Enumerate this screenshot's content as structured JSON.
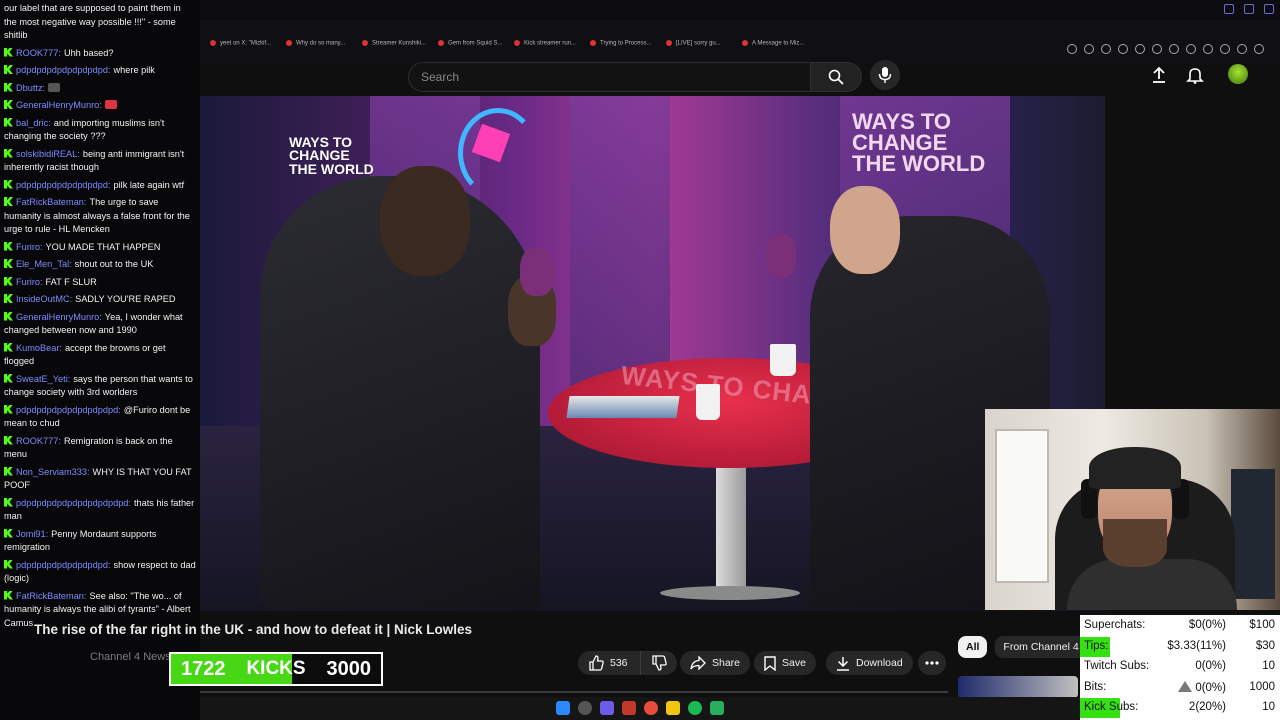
{
  "browser": {
    "bookmarks": [
      "yeet on X: \"Mizkif...",
      "Why do so many...",
      "Streamer Kunshiki...",
      "Gem from Squid S...",
      "Kick streamer run...",
      "Trying to Process...",
      "[LIVE] sorry gu...",
      "A Message to Miz..."
    ]
  },
  "youtube": {
    "search_placeholder": "Search",
    "video_title": "The rise of the far right in the UK - and how to defeat it | Nick Lowles",
    "channel_ghost": "Channel 4 News",
    "likes": "536",
    "share_label": "Share",
    "save_label": "Save",
    "download_label": "Download",
    "chips": [
      "All",
      "From Channel 4"
    ],
    "video_overlay": {
      "logo_left": [
        "WAYS TO",
        "CHANGE",
        "THE WORLD"
      ],
      "logo_right": [
        "WAYS TO",
        "CHANGE",
        "THE WORLD"
      ],
      "table_text": "WAYS TO CHANGE THE WORLD"
    }
  },
  "chat": {
    "messages": [
      {
        "user": "",
        "text": "our label that are supposed to paint them in the most negative way possible !!!\" - some shitlib"
      },
      {
        "user": "ROOK777:",
        "text": "Uhh based?"
      },
      {
        "user": "pdpdpdpdpdpdpdpdpd:",
        "text": "where pilk"
      },
      {
        "user": "Dbuttz:",
        "text": ""
      },
      {
        "user": "GeneralHenryMunro:",
        "text": ""
      },
      {
        "user": "bal_dric:",
        "text": "and importing muslims isn't changing the society ???"
      },
      {
        "user": "solskibidiREAL:",
        "text": "being anti immigrant isn't inherently racist though"
      },
      {
        "user": "pdpdpdpdpdpdpdpdpd:",
        "text": "pilk late again wtf"
      },
      {
        "user": "FatRickBateman:",
        "text": "The urge to save humanity is almost always a false front for the urge to rule - HL Mencken"
      },
      {
        "user": "Furiro:",
        "text": "YOU MADE THAT HAPPEN"
      },
      {
        "user": "Ele_Men_Tal:",
        "text": "shout out to the UK"
      },
      {
        "user": "Furiro:",
        "text": "FAT F SLUR"
      },
      {
        "user": "InsideOutMC:",
        "text": "SADLY YOU'RE RAPED"
      },
      {
        "user": "GeneralHenryMunro:",
        "text": "Yea, I wonder what changed between now and 1990"
      },
      {
        "user": "KumoBear:",
        "text": "accept the browns or get flogged"
      },
      {
        "user": "SweatE_Yeti:",
        "text": "says the person that wants to change society with 3rd worlders"
      },
      {
        "user": "pdpdpdpdpdpdpdpdpdpd:",
        "text": "@Furiro dont be mean to chud"
      },
      {
        "user": "ROOK777:",
        "text": "Remigration is back on the menu"
      },
      {
        "user": "Non_Serviam333:",
        "text": "WHY IS THAT YOU FAT POOF"
      },
      {
        "user": "pdpdpdpdpdpdpdpdpdpdpd:",
        "text": "thats his father man"
      },
      {
        "user": "Jomi91:",
        "text": "Penny Mordaunt supports remigration"
      },
      {
        "user": "pdpdpdpdpdpdpdpdpd:",
        "text": "show respect to dad (logic)"
      },
      {
        "user": "FatRickBateman:",
        "text": "See also: \"The wo... of humanity is always the alibi of tyrants\" - Albert Camus"
      }
    ]
  },
  "kicks_goal": {
    "current": "1722",
    "label": "KICKS",
    "target": "3000",
    "progress_fraction": 0.574
  },
  "stats": {
    "rows": [
      {
        "key": "Superchats:",
        "value": "$0(0%)",
        "goal": "$100",
        "highlight": false,
        "warn": false
      },
      {
        "key": "Tips:",
        "value": "$3.33(11%)",
        "goal": "$30",
        "highlight": true,
        "fraction": 0.11,
        "warn": false
      },
      {
        "key": "Twitch Subs:",
        "value": "0(0%)",
        "goal": "10",
        "highlight": false,
        "warn": false
      },
      {
        "key": "Bits:",
        "value": "0(0%)",
        "goal": "1000",
        "highlight": false,
        "warn": true
      },
      {
        "key": "Kick Subs:",
        "value": "2(20%)",
        "goal": "10",
        "highlight": true,
        "fraction": 0.2,
        "warn": false
      }
    ]
  },
  "colors": {
    "kick_green": "#53fc18",
    "stat_green": "#35e112",
    "chat_username": "#7d8bff",
    "youtube_bg": "#0f0f0f"
  }
}
